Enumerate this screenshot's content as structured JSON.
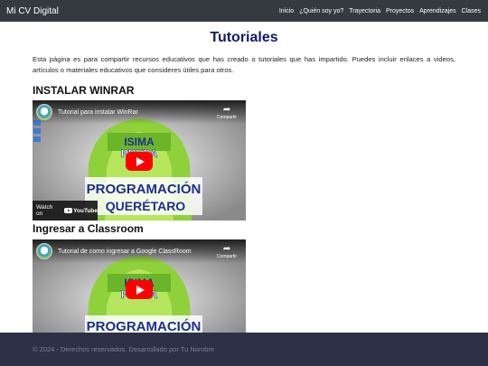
{
  "navbar": {
    "brand": "Mi CV Digital",
    "links": [
      "Inicio",
      "¿Quién soy yo?",
      "Trayectoria",
      "Proyectos",
      "Aprendizajes",
      "Clases"
    ],
    "bg_color": "#343a40"
  },
  "main": {
    "title": "Tutoriales",
    "intro": "Esta página es para compartir recursos educativos que has creado o tutoriales que has impartido. Puedes incluir enlaces a videos, artículos o materiales educativos que consideres útiles para otros.",
    "sections": [
      {
        "heading": "INSTALAR WINRAR",
        "video": {
          "title": "Tutorial para instalar WinRar",
          "share_label": "Compartir",
          "watch_on": "Watch on",
          "platform": "YouTube",
          "thumb_top": "ISIMA",
          "thumb_sub": "PREPA",
          "thumb_banner_1": "PROGRAMACIÓN",
          "thumb_banner_2": "QUERÉTARO"
        }
      },
      {
        "heading": "Ingresar a Classroom",
        "video": {
          "title": "Tutorial de como ingresar a Google ClassRoom",
          "share_label": "Compartir",
          "thumb_top": "ISIMA",
          "thumb_sub": "PREPA",
          "thumb_banner_1": "PROGRAMACIÓN"
        }
      }
    ]
  },
  "footer": {
    "text": "© 2024 - Derechos reservados. Desarrollado por Tu Nombre",
    "bg_color": "#2e3048"
  }
}
